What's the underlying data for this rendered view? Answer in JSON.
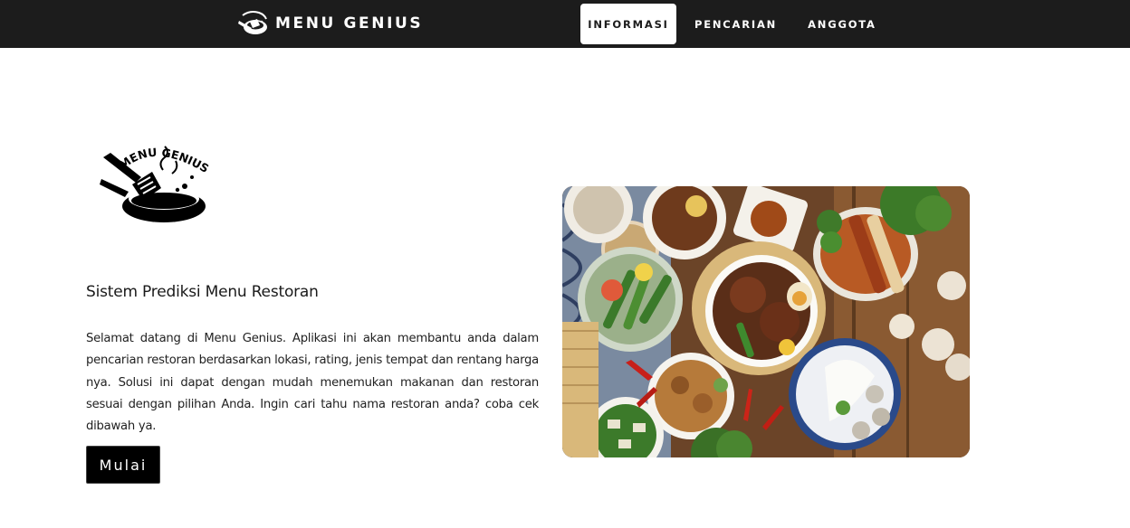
{
  "header": {
    "brand": "MENU GENIUS",
    "brand_logo_icon": "menu-genius-logo-icon",
    "nav": [
      {
        "label": "INFORMASI",
        "active": true
      },
      {
        "label": "PENCARIAN",
        "active": false
      },
      {
        "label": "ANGGOTA",
        "active": false
      }
    ]
  },
  "main": {
    "logo_text": "MENU GENIUS",
    "tagline": "Sistem Prediksi Menu Restoran",
    "description": "Selamat datang di Menu Genius. Aplikasi ini akan membantu anda dalam pencarian restoran berdasarkan lokasi, rating, jenis tempat dan rentang harga nya. Solusi ini dapat dengan mudah menemukan makanan dan restoran sesuai dengan pilihan Anda. Ingin cari tahu nama restoran anda? coba cek dibawah ya.",
    "start_button": "Mulai"
  },
  "colors": {
    "navbar_bg": "#1c1c1c",
    "button_bg": "#000000",
    "page_bg": "#ffffff"
  }
}
